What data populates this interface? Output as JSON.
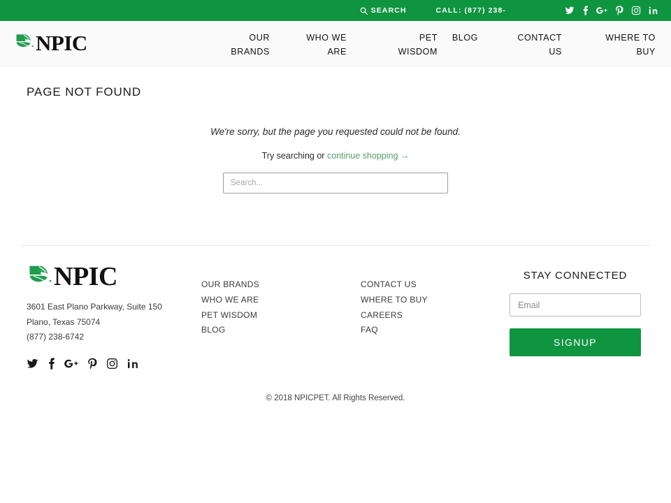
{
  "colors": {
    "brand_green": "#0f9440",
    "link_green": "#5a9a6f",
    "header_bg": "#fafafa",
    "text_dark": "#222222"
  },
  "topbar": {
    "search_label": "SEARCH",
    "search_icon": "search-icon",
    "call_label": "CALL: (877) 238-",
    "social": [
      {
        "name": "twitter-icon",
        "label": "Twitter"
      },
      {
        "name": "facebook-icon",
        "label": "Facebook"
      },
      {
        "name": "google-plus-icon",
        "label": "Google Plus"
      },
      {
        "name": "pinterest-icon",
        "label": "Pinterest"
      },
      {
        "name": "instagram-icon",
        "label": "Instagram"
      },
      {
        "name": "linkedin-icon",
        "label": "LinkedIn"
      }
    ]
  },
  "header": {
    "logo_text": "NPIC",
    "logo_icon": "leaf-icon",
    "nav": [
      {
        "label": "OUR BRANDS"
      },
      {
        "label": "WHO WE ARE"
      },
      {
        "label": "PET WISDOM"
      },
      {
        "label": "BLOG"
      },
      {
        "label": "CONTACT US"
      },
      {
        "label": "WHERE TO BUY"
      }
    ]
  },
  "main": {
    "page_title": "PAGE NOT FOUND",
    "error_message": "We're sorry, but the page you requested could not be found.",
    "try_prefix": "Try searching or ",
    "continue_link": "continue shopping →",
    "search_placeholder": "Search...",
    "search_value": ""
  },
  "footer": {
    "logo_text": "NPIC",
    "logo_icon": "leaf-icon",
    "address_line1": "3601 East Plano Parkway, Suite 150",
    "address_line2": "Plano, Texas 75074",
    "phone": "(877) 238-6742",
    "social": [
      {
        "name": "twitter-icon",
        "label": "Twitter"
      },
      {
        "name": "facebook-icon",
        "label": "Facebook"
      },
      {
        "name": "google-plus-icon",
        "label": "Google Plus"
      },
      {
        "name": "pinterest-icon",
        "label": "Pinterest"
      },
      {
        "name": "instagram-icon",
        "label": "Instagram"
      },
      {
        "name": "linkedin-icon",
        "label": "LinkedIn"
      }
    ],
    "links_col1": [
      {
        "label": "OUR BRANDS"
      },
      {
        "label": "WHO WE ARE"
      },
      {
        "label": "PET WISDOM"
      },
      {
        "label": "BLOG"
      }
    ],
    "links_col2": [
      {
        "label": "CONTACT US"
      },
      {
        "label": "WHERE TO BUY"
      },
      {
        "label": "CAREERS"
      },
      {
        "label": "FAQ"
      }
    ],
    "connect_title": "STAY CONNECTED",
    "email_placeholder": "Email",
    "email_value": "",
    "signup_label": "SIGNUP",
    "copyright": "© 2018 NPICPET. All Rights Reserved."
  }
}
